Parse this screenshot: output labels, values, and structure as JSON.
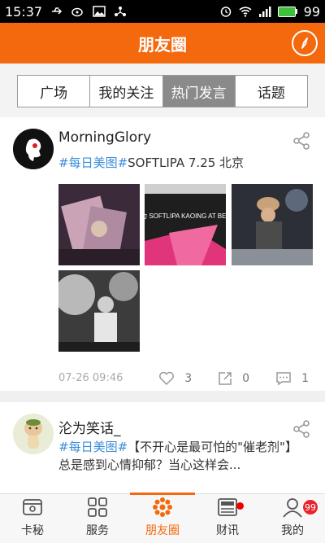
{
  "status_bar": {
    "time": "15:37",
    "battery": "99"
  },
  "header": {
    "title": "朋友圈"
  },
  "tabs": [
    {
      "label": "广场",
      "active": false
    },
    {
      "label": "我的关注",
      "active": false
    },
    {
      "label": "热门发言",
      "active": true
    },
    {
      "label": "话题",
      "active": false
    }
  ],
  "posts": [
    {
      "username": "MorningGlory",
      "tag": "#每日美图#",
      "text": "SOFTLIPA 7.25 北京",
      "photo_caption": "新势力 SOFTLIPA KAOING AT BEIJING",
      "time": "07-26 09:46",
      "likes": "3",
      "shares": "0",
      "comments": "1"
    },
    {
      "username": "沦为笑话_",
      "tag": "#每日美图#",
      "text": "【不开心是最可怕的\"催老剂\"】总是感到心情抑郁？当心这样会..."
    }
  ],
  "bottom_nav": [
    {
      "label": "卡秘",
      "icon": "card-icon",
      "active": false
    },
    {
      "label": "服务",
      "icon": "grid-icon",
      "active": false
    },
    {
      "label": "朋友圈",
      "icon": "flower-icon",
      "active": true
    },
    {
      "label": "财讯",
      "icon": "news-icon",
      "active": false,
      "dot": true
    },
    {
      "label": "我的",
      "icon": "profile-icon",
      "active": false,
      "badge": "99"
    }
  ],
  "colors": {
    "brand": "#f4690d",
    "tag": "#3a8cd9",
    "tab_active": "#8a8a8a"
  }
}
